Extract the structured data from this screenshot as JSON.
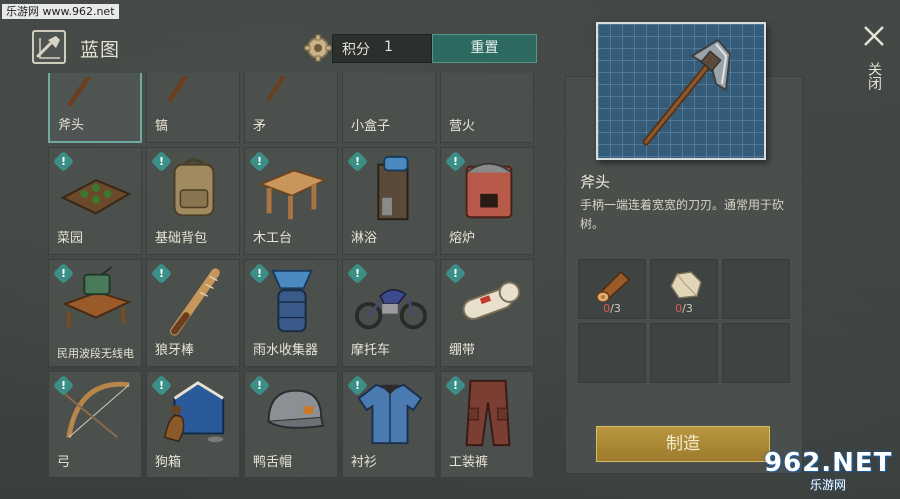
{
  "watermark_top": "乐游网 www.962.net",
  "header": {
    "title": "蓝图",
    "points_label": "积分",
    "points_value": "1",
    "reset_label": "重置"
  },
  "grid": {
    "rows": [
      [
        {
          "label": "斧头",
          "icon": "axe-icon",
          "badge": false,
          "selected": true
        },
        {
          "label": "镐",
          "icon": "pickaxe-icon",
          "badge": false,
          "selected": false
        },
        {
          "label": "矛",
          "icon": "spear-icon",
          "badge": false,
          "selected": false
        },
        {
          "label": "小盒子",
          "icon": "small-box-icon",
          "badge": false,
          "selected": false
        },
        {
          "label": "营火",
          "icon": "campfire-icon",
          "badge": false,
          "selected": false
        }
      ],
      [
        {
          "label": "菜园",
          "icon": "garden-bed-icon",
          "badge": true,
          "selected": false
        },
        {
          "label": "基础背包",
          "icon": "backpack-icon",
          "badge": true,
          "selected": false
        },
        {
          "label": "木工台",
          "icon": "workbench-icon",
          "badge": true,
          "selected": false
        },
        {
          "label": "淋浴",
          "icon": "shower-icon",
          "badge": true,
          "selected": false
        },
        {
          "label": "熔炉",
          "icon": "furnace-icon",
          "badge": true,
          "selected": false
        }
      ],
      [
        {
          "label": "民用波段无线电",
          "icon": "radio-icon",
          "badge": true,
          "selected": false
        },
        {
          "label": "狼牙棒",
          "icon": "spiked-club-icon",
          "badge": true,
          "selected": false
        },
        {
          "label": "雨水收集器",
          "icon": "rain-collector-icon",
          "badge": true,
          "selected": false
        },
        {
          "label": "摩托车",
          "icon": "motorcycle-icon",
          "badge": true,
          "selected": false
        },
        {
          "label": "绷带",
          "icon": "bandage-icon",
          "badge": true,
          "selected": false
        }
      ],
      [
        {
          "label": "弓",
          "icon": "bow-icon",
          "badge": true,
          "selected": false
        },
        {
          "label": "狗箱",
          "icon": "dog-kennel-icon",
          "badge": true,
          "selected": false
        },
        {
          "label": "鸭舌帽",
          "icon": "cap-icon",
          "badge": true,
          "selected": false
        },
        {
          "label": "衬衫",
          "icon": "shirt-icon",
          "badge": true,
          "selected": false
        },
        {
          "label": "工装裤",
          "icon": "cargo-pants-icon",
          "badge": true,
          "selected": false
        }
      ]
    ],
    "badge_symbol": "!"
  },
  "detail": {
    "name": "斧头",
    "description": "手柄一端连着宽宽的刀刃。通常用于砍树。",
    "materials": [
      {
        "icon": "wood-log-icon",
        "have": "0",
        "need": "/3"
      },
      {
        "icon": "stone-icon",
        "have": "0",
        "need": "/3"
      }
    ],
    "craft_label": "制造"
  },
  "close_label": "关闭",
  "watermark_bottom": {
    "number": "962.NET",
    "sub": "乐游网"
  },
  "colors": {
    "accent_teal": "#2f6a62",
    "craft_gold": "#b9963e",
    "missing_red": "#e05a4a",
    "badge_teal": "#3b8f86"
  }
}
